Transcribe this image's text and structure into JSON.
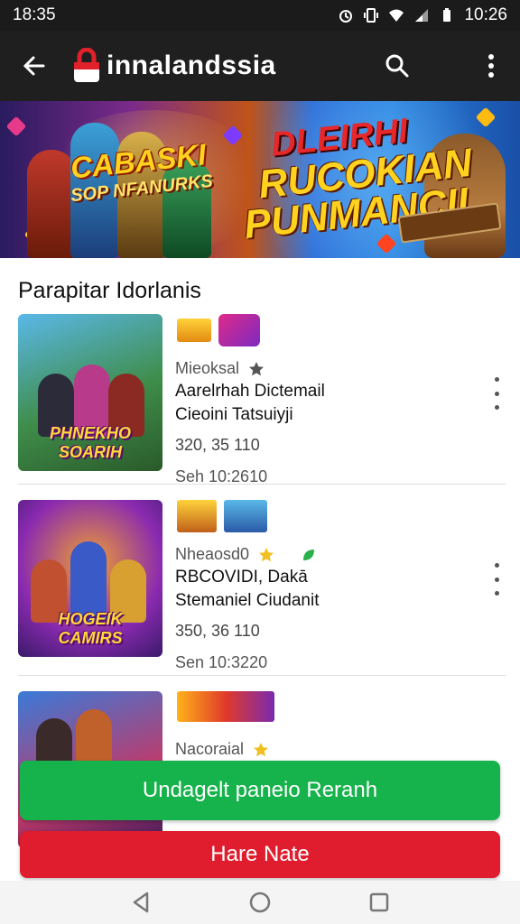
{
  "status_bar": {
    "time": "18:35",
    "right_text": "10:26",
    "icons": [
      "alarm-icon",
      "vibrate-icon",
      "wifi-icon",
      "signal-icon",
      "battery-icon"
    ]
  },
  "app_bar": {
    "title": "innalandssia",
    "icons": [
      "back-arrow-icon",
      "app-logo-icon",
      "search-icon",
      "more-vert-icon"
    ]
  },
  "banner": {
    "left_title": "CABASKI",
    "left_subtitle": "SOP NFANURKS",
    "right_line1": "DLEIRHI",
    "right_line2": "RUCOKIAN",
    "right_line3": "PUNMANCII"
  },
  "section": {
    "title": "Parapitar Idorlanis"
  },
  "items": [
    {
      "thumb_label": "PHNEKHO SOARIH",
      "category": "Mieoksal",
      "line1": "Aarelrhah Dictemail",
      "line2": "Cieoini Tatsuiyji",
      "count": "320, 35 110",
      "time": "Seh 10:2610"
    },
    {
      "thumb_label": "HOGEIK CAMIRS",
      "category": "Nheaosd0",
      "line1": "RBCOVIDI, Dakā",
      "line2": "Stemaniel Ciudanit",
      "count": "350, 36 110",
      "time": "Sen 10:3220"
    },
    {
      "thumb_label": "",
      "category": "Nacoraial",
      "line1": "",
      "line2": "",
      "count": "",
      "time": ""
    }
  ],
  "buttons": {
    "primary": "Undagelt paneio Reranh",
    "secondary": "Hare Nate"
  },
  "colors": {
    "app_bar": "#1f1f1f",
    "primary_button": "#16b24b",
    "secondary_button": "#e01d2e",
    "logo": "#e0202a"
  }
}
